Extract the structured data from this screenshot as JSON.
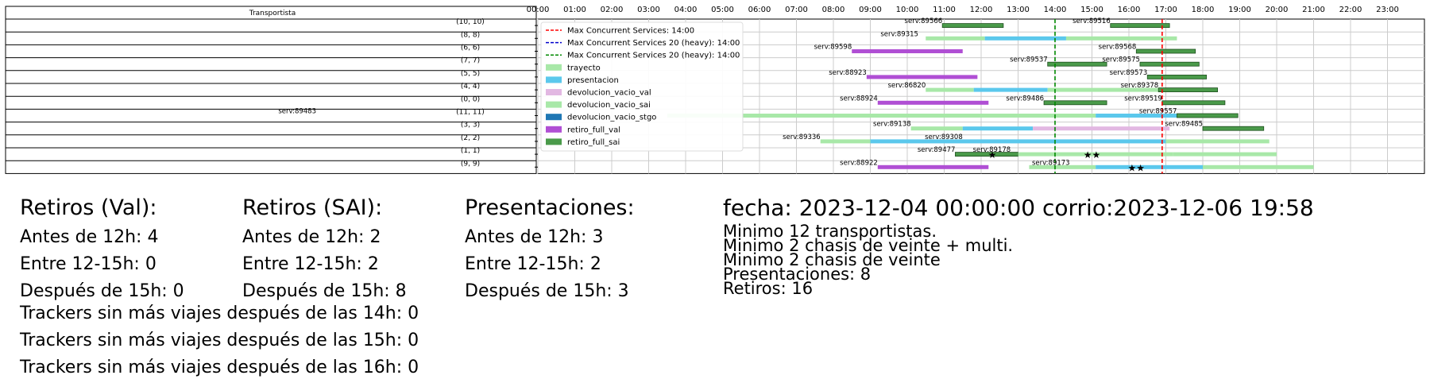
{
  "chart_data": {
    "type": "gantt",
    "table_header": "Transportista",
    "rows": [
      "(10, 10)",
      "(8, 8)",
      "(6, 6)",
      "(7, 7)",
      "(5, 5)",
      "(4, 4)",
      "(0, 0)",
      "(11, 11)",
      "(3, 3)",
      "(2, 2)",
      "(1, 1)",
      "(9, 9)"
    ],
    "x_ticks": [
      "00:00",
      "01:00",
      "02:00",
      "03:00",
      "04:00",
      "05:00",
      "06:00",
      "07:00",
      "08:00",
      "09:00",
      "10:00",
      "11:00",
      "12:00",
      "13:00",
      "14:00",
      "15:00",
      "16:00",
      "17:00",
      "18:00",
      "19:00",
      "20:00",
      "21:00",
      "22:00",
      "23:00"
    ],
    "xlim": [
      0,
      24
    ],
    "grid": true,
    "legend_position": "upper-left",
    "colors": {
      "trayecto": "#a8e8a8",
      "presentacion": "#5bc8ec",
      "devolucion_vacio_val": "#e2b8e2",
      "devolucion_vacio_sai": "#a8e8a8",
      "devolucion_vacio_stgo": "#1f77b4",
      "retiro_full_val": "#b04fd4",
      "retiro_full_sai": "#4a9a4a"
    },
    "legend": [
      {
        "label": "Max Concurrent Services: 14:00",
        "kind": "line",
        "color": "#ff0000"
      },
      {
        "label": "Max Concurrent Services 20 (heavy): 14:00",
        "kind": "line",
        "color": "#0000cc"
      },
      {
        "label": "Max Concurrent Services 20 (heavy): 14:00",
        "kind": "line",
        "color": "#008800"
      },
      {
        "label": "trayecto",
        "kind": "patch",
        "key": "trayecto"
      },
      {
        "label": "presentacion",
        "kind": "patch",
        "key": "presentacion"
      },
      {
        "label": "devolucion_vacio_val",
        "kind": "patch",
        "key": "devolucion_vacio_val"
      },
      {
        "label": "devolucion_vacio_sai",
        "kind": "patch",
        "key": "devolucion_vacio_sai"
      },
      {
        "label": "devolucion_vacio_stgo",
        "kind": "patch",
        "key": "devolucion_vacio_stgo"
      },
      {
        "label": "retiro_full_val",
        "kind": "patch",
        "key": "retiro_full_val"
      },
      {
        "label": "retiro_full_sai",
        "kind": "patch",
        "key": "retiro_full_sai"
      }
    ],
    "vlines": [
      {
        "x": 14.0,
        "color": "#008800",
        "style": "dashed"
      },
      {
        "x": 16.9,
        "color": "#ff0000",
        "style": "dashed"
      }
    ],
    "segments": [
      {
        "row": 0,
        "start": 10.95,
        "end": 12.6,
        "type": "retiro_full_sai"
      },
      {
        "row": 0,
        "start": 15.5,
        "end": 17.1,
        "type": "retiro_full_sai"
      },
      {
        "row": 1,
        "start": 10.5,
        "end": 12.1,
        "type": "trayecto"
      },
      {
        "row": 1,
        "start": 12.1,
        "end": 14.3,
        "type": "presentacion"
      },
      {
        "row": 1,
        "start": 14.3,
        "end": 17.3,
        "type": "trayecto"
      },
      {
        "row": 2,
        "start": 8.5,
        "end": 11.5,
        "type": "retiro_full_val"
      },
      {
        "row": 2,
        "start": 16.2,
        "end": 17.8,
        "type": "retiro_full_sai"
      },
      {
        "row": 3,
        "start": 13.8,
        "end": 15.4,
        "type": "retiro_full_sai"
      },
      {
        "row": 3,
        "start": 16.3,
        "end": 17.9,
        "type": "retiro_full_sai"
      },
      {
        "row": 4,
        "start": 8.9,
        "end": 11.9,
        "type": "retiro_full_val"
      },
      {
        "row": 4,
        "start": 16.5,
        "end": 18.1,
        "type": "retiro_full_sai"
      },
      {
        "row": 5,
        "start": 10.5,
        "end": 11.8,
        "type": "trayecto"
      },
      {
        "row": 5,
        "start": 11.8,
        "end": 13.8,
        "type": "presentacion"
      },
      {
        "row": 5,
        "start": 13.8,
        "end": 16.8,
        "type": "trayecto"
      },
      {
        "row": 5,
        "start": 16.8,
        "end": 18.4,
        "type": "retiro_full_sai"
      },
      {
        "row": 6,
        "start": 9.2,
        "end": 12.2,
        "type": "retiro_full_val"
      },
      {
        "row": 6,
        "start": 13.7,
        "end": 15.4,
        "type": "retiro_full_sai"
      },
      {
        "row": 6,
        "start": 16.9,
        "end": 18.6,
        "type": "retiro_full_sai"
      },
      {
        "row": 7,
        "start": 3.5,
        "end": 15.1,
        "type": "trayecto"
      },
      {
        "row": 7,
        "start": 15.1,
        "end": 17.3,
        "type": "presentacion"
      },
      {
        "row": 7,
        "start": 17.3,
        "end": 18.95,
        "type": "retiro_full_sai"
      },
      {
        "row": 8,
        "start": 10.1,
        "end": 11.5,
        "type": "trayecto"
      },
      {
        "row": 8,
        "start": 11.5,
        "end": 13.4,
        "type": "presentacion"
      },
      {
        "row": 8,
        "start": 13.4,
        "end": 17.1,
        "type": "devolucion_vacio_val"
      },
      {
        "row": 8,
        "start": 18.0,
        "end": 19.65,
        "type": "retiro_full_sai"
      },
      {
        "row": 9,
        "start": 7.65,
        "end": 9.0,
        "type": "trayecto"
      },
      {
        "row": 9,
        "start": 9.0,
        "end": 17.0,
        "type": "presentacion"
      },
      {
        "row": 9,
        "start": 17.0,
        "end": 19.8,
        "type": "trayecto"
      },
      {
        "row": 10,
        "start": 11.3,
        "end": 13.0,
        "type": "retiro_full_sai"
      },
      {
        "row": 10,
        "start": 13.0,
        "end": 17.2,
        "type": "trayecto"
      },
      {
        "row": 10,
        "start": 17.2,
        "end": 20.0,
        "type": "trayecto"
      },
      {
        "row": 11,
        "start": 9.2,
        "end": 12.2,
        "type": "retiro_full_val"
      },
      {
        "row": 11,
        "start": 13.3,
        "end": 15.1,
        "type": "trayecto"
      },
      {
        "row": 11,
        "start": 15.1,
        "end": 18.0,
        "type": "presentacion"
      },
      {
        "row": 11,
        "start": 18.0,
        "end": 21.0,
        "type": "trayecto"
      }
    ],
    "annotations": [
      {
        "row": 0,
        "x": 10.95,
        "text": "serv:89566"
      },
      {
        "row": 0,
        "x": 15.5,
        "text": "serv:89516"
      },
      {
        "row": 1,
        "x": 10.3,
        "text": "serv:89315"
      },
      {
        "row": 2,
        "x": 8.5,
        "text": "serv:89598"
      },
      {
        "row": 2,
        "x": 16.2,
        "text": "serv:89568"
      },
      {
        "row": 3,
        "x": 13.8,
        "text": "serv:89537"
      },
      {
        "row": 3,
        "x": 16.3,
        "text": "serv:89575"
      },
      {
        "row": 4,
        "x": 8.9,
        "text": "serv:88923"
      },
      {
        "row": 4,
        "x": 16.5,
        "text": "serv:89573"
      },
      {
        "row": 5,
        "x": 10.5,
        "text": "serv:86820"
      },
      {
        "row": 5,
        "x": 16.8,
        "text": "serv:89378"
      },
      {
        "row": 6,
        "x": 9.2,
        "text": "serv:88924"
      },
      {
        "row": 6,
        "x": 13.7,
        "text": "serv:89486"
      },
      {
        "row": 6,
        "x": 16.9,
        "text": "serv:89519"
      },
      {
        "row": 7,
        "x": -6.0,
        "text": "serv:89483"
      },
      {
        "row": 7,
        "x": 17.3,
        "text": "serv:89557"
      },
      {
        "row": 8,
        "x": 10.1,
        "text": "serv:89138"
      },
      {
        "row": 8,
        "x": 18.0,
        "text": "serv:89485"
      },
      {
        "row": 9,
        "x": 7.65,
        "text": "serv:89336"
      },
      {
        "row": 9,
        "x": 11.5,
        "text": "serv:89308"
      },
      {
        "row": 10,
        "x": 11.3,
        "text": "serv:89477"
      },
      {
        "row": 10,
        "x": 12.8,
        "text": "serv:89178"
      },
      {
        "row": 11,
        "x": 9.2,
        "text": "serv:88922"
      },
      {
        "row": 11,
        "x": 14.4,
        "text": "serv:89173"
      }
    ],
    "markers": [
      {
        "row": 10,
        "x": 12.3,
        "symbol": "★"
      },
      {
        "row": 10,
        "x": 15.0,
        "symbol": "★★"
      },
      {
        "row": 11,
        "x": 16.2,
        "symbol": "★★"
      }
    ]
  },
  "summary": {
    "retiros_val": {
      "title": "Retiros (Val):",
      "antes": "Antes de 12h: 4",
      "entre": "Entre 12-15h: 0",
      "despues": "Después de 15h: 0"
    },
    "retiros_sai": {
      "title": "Retiros (SAI):",
      "antes": "Antes de 12h: 2",
      "entre": "Entre 12-15h: 2",
      "despues": "Después de 15h: 8"
    },
    "presentaciones": {
      "title": "Presentaciones:",
      "antes": "Antes de 12h: 3",
      "entre": "Entre 12-15h: 2",
      "despues": "Después de 15h: 3"
    },
    "info": {
      "header": "fecha: 2023-12-04 00:00:00  corrio:2023-12-06 19:58",
      "lines": [
        "Minimo 12 transportistas.",
        "Minimo 2 chasis de veinte + multi.",
        "Minimo 2 chasis de veinte",
        "Presentaciones: 8",
        "Retiros: 16"
      ]
    },
    "trackers": [
      "Trackers sin más viajes después de las 14h: 0",
      "Trackers sin más viajes después de las 15h: 0",
      "Trackers sin más viajes después de las 16h: 0"
    ]
  }
}
